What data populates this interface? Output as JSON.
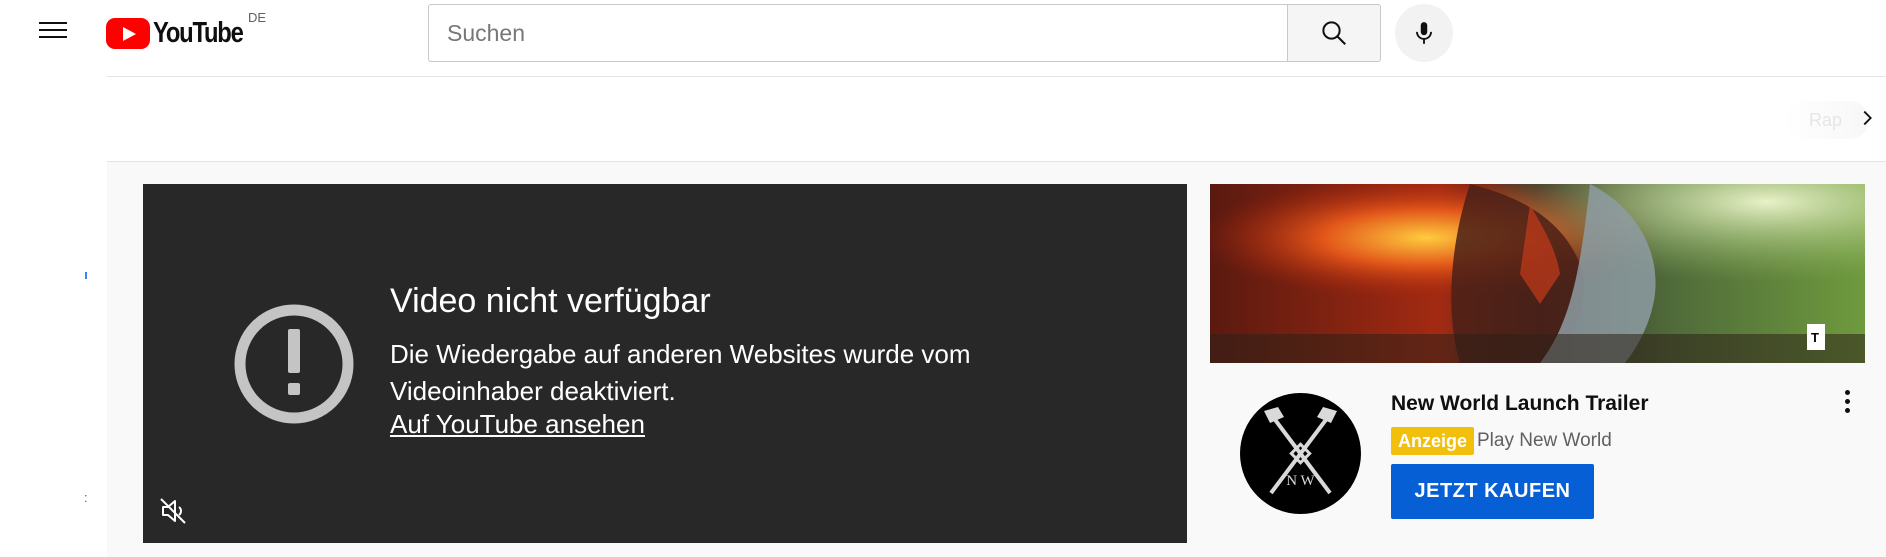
{
  "header": {
    "logo_text": "YouTube",
    "region": "DE",
    "search_placeholder": "Suchen",
    "menu_icon": "hamburger-menu-icon",
    "search_icon": "search-icon",
    "mic_icon": "microphone-icon"
  },
  "chips": {
    "faded_chip_label": "Rap",
    "next_icon": "chevron-right-icon"
  },
  "player": {
    "error_icon": "exclamation-circle-icon",
    "title": "Video nicht verfügbar",
    "message": "Die Wiedergabe auf anderen Websites wurde vom Videoinhaber deaktiviert.",
    "link": "Auf YouTube ansehen",
    "mute_icon": "volume-muted-icon"
  },
  "ad": {
    "banner_image": "new-world-game-banner",
    "avatar_text": "N W",
    "title": "New World Launch Trailer",
    "badge": "Anzeige",
    "channel": "Play New World",
    "cta": "JETZT KAUFEN",
    "more_icon": "more-vertical-icon"
  },
  "colors": {
    "brand_red": "#ff0000",
    "player_bg": "#282828",
    "cta_blue": "#065fd4",
    "ad_badge": "#f2c00c"
  }
}
